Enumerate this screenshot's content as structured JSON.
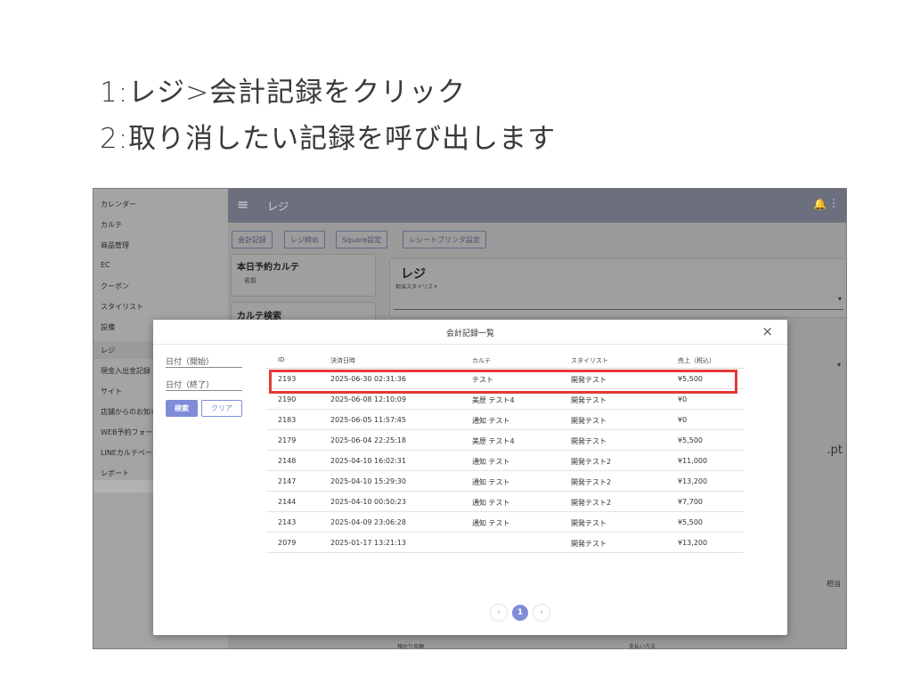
{
  "instructions": {
    "line1": "1:レジ>会計記録をクリック",
    "line2": "2:取り消したい記録を呼び出します"
  },
  "sidebar": {
    "items": [
      "カレンダー",
      "カルテ",
      "商品管理",
      "EC",
      "クーポン",
      "スタイリスト",
      "設備",
      "レジ",
      "現金入出金記録",
      "サイト",
      "店舗からのお知ら",
      "WEB予約フォーム",
      "LINEカルテページ",
      "レポート"
    ]
  },
  "topbar": {
    "title": "レジ"
  },
  "tabs": [
    "会計記録",
    "レジ締め",
    "Square設定",
    "レシートプリンタ設定"
  ],
  "bg": {
    "today_card_title": "本日予約カルテ",
    "today_card_sub": "名前",
    "search_card_title": "カルテ検索",
    "register_title": "レジ",
    "register_sub": "担当スタイリスト",
    "pt_suffix": ".pt",
    "equivalent": "相当",
    "deposit_label": "預かり金額",
    "payment_label": "支払い方法"
  },
  "modal": {
    "title": "会計記録一覧",
    "close": "×",
    "filter": {
      "start_label": "日付（開始）",
      "end_label": "日付（終了）",
      "search_button": "検索",
      "clear_button": "クリア"
    },
    "columns": {
      "id": "ID",
      "date": "決済日時",
      "karte": "カルテ",
      "stylist": "スタイリスト",
      "sales": "売上（税込）"
    },
    "rows": [
      {
        "id": "2193",
        "date": "2025-06-30 02:31:36",
        "karte": "テスト",
        "stylist": "開発テスト",
        "sales": "¥5,500"
      },
      {
        "id": "2190",
        "date": "2025-06-08 12:10:09",
        "karte": "美歴 テスト4",
        "stylist": "開発テスト",
        "sales": "¥0"
      },
      {
        "id": "2183",
        "date": "2025-06-05 11:57:45",
        "karte": "通知 テスト",
        "stylist": "開発テスト",
        "sales": "¥0"
      },
      {
        "id": "2179",
        "date": "2025-06-04 22:25:18",
        "karte": "美歴 テスト4",
        "stylist": "開発テスト",
        "sales": "¥5,500"
      },
      {
        "id": "2148",
        "date": "2025-04-10 16:02:31",
        "karte": "通知 テスト",
        "stylist": "開発テスト2",
        "sales": "¥11,000"
      },
      {
        "id": "2147",
        "date": "2025-04-10 15:29:30",
        "karte": "通知 テスト",
        "stylist": "開発テスト2",
        "sales": "¥13,200"
      },
      {
        "id": "2144",
        "date": "2025-04-10 00:50:23",
        "karte": "通知 テスト",
        "stylist": "開発テスト2",
        "sales": "¥7,700"
      },
      {
        "id": "2143",
        "date": "2025-04-09 23:06:28",
        "karte": "通知 テスト",
        "stylist": "開発テスト",
        "sales": "¥5,500"
      },
      {
        "id": "2079",
        "date": "2025-01-17 13:21:13",
        "karte": "",
        "stylist": "開発テスト",
        "sales": "¥13,200"
      }
    ],
    "pagination": {
      "prev": "‹",
      "current": "1",
      "next": "›"
    }
  },
  "colors": {
    "accent": "#7f8cd9",
    "highlight": "#e53935",
    "topbar": "#6c6f7e"
  }
}
